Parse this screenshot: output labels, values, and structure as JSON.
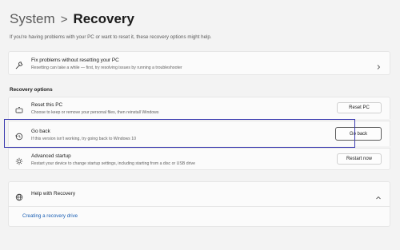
{
  "breadcrumb": {
    "parent": "System",
    "separator": ">",
    "current": "Recovery"
  },
  "subtitle": "If you're having problems with your PC or want to reset it, these recovery options might help.",
  "fix": {
    "title": "Fix problems without resetting your PC",
    "description": "Resetting can take a while — first, try resolving issues by running a troubleshooter",
    "icon": "wrench-icon"
  },
  "recovery_options": {
    "label": "Recovery options",
    "items": [
      {
        "title": "Reset this PC",
        "description": "Choose to keep or remove your personal files, then reinstall Windows",
        "button": "Reset PC",
        "icon": "reset-pc-icon"
      },
      {
        "title": "Go back",
        "description": "If this version isn't working, try going back to Windows 10",
        "button": "Go back",
        "icon": "history-icon"
      },
      {
        "title": "Advanced startup",
        "description": "Restart your device to change startup settings, including starting from a disc or USB drive",
        "button": "Restart now",
        "icon": "advanced-startup-icon"
      }
    ]
  },
  "help": {
    "title": "Help with Recovery",
    "link": "Creating a recovery drive",
    "icon": "globe-icon"
  },
  "colors": {
    "highlight": "#3b3bb0",
    "link": "#1a5fb4",
    "background": "#f3f3f3"
  }
}
